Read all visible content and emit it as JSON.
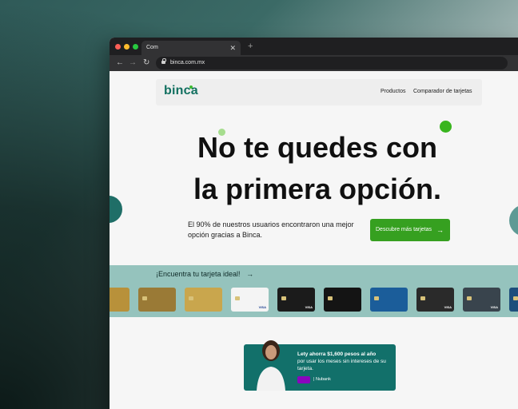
{
  "browser": {
    "tab_title": "Com",
    "tab_close": "✕",
    "new_tab": "+",
    "url": "binca.com.mx",
    "nav_back": "←",
    "nav_forward": "→",
    "reload": "↻"
  },
  "site": {
    "logo": "binca",
    "nav": {
      "products": "Productos",
      "comparator": "Comparador de tarjetas"
    }
  },
  "hero": {
    "line1": "No te quedes con",
    "line2": "la primera opción.",
    "subtitle": "El 90% de nuestros usuarios encontraron una mejor opción gracias a Binca.",
    "cta": "Descubre más tarjetas",
    "cta_arrow": "→"
  },
  "cards_band": {
    "label": "¡Encuentra tu tarjeta ideal!",
    "arrow": "→",
    "cards": [
      {
        "name": "gold-card",
        "color": "#b8913a",
        "brand": ""
      },
      {
        "name": "aeromexico-card",
        "color": "#9a7a36",
        "brand": ""
      },
      {
        "name": "amex-gold-card",
        "color": "#c9a64d",
        "brand": ""
      },
      {
        "name": "white-card",
        "color": "#f4f4f4",
        "brand": "VISA"
      },
      {
        "name": "black-card",
        "color": "#1b1b1b",
        "brand": "VISA"
      },
      {
        "name": "santander-black-card",
        "color": "#141414",
        "brand": ""
      },
      {
        "name": "citibanamex-card",
        "color": "#1b5d9a",
        "brand": ""
      },
      {
        "name": "dark-card",
        "color": "#2a2a2a",
        "brand": "VISA"
      },
      {
        "name": "banregio-card",
        "color": "#39444d",
        "brand": "VISA"
      },
      {
        "name": "blue-card",
        "color": "#1d4e7c",
        "brand": "VISA"
      }
    ]
  },
  "promo": {
    "line1": "Lety ahorra $1,600 pesos al año",
    "line2": "por usar los meses sin intereses de su tarjeta.",
    "brand": "| Nubank"
  },
  "colors": {
    "accent_green": "#36a020",
    "brand_teal": "#127060",
    "band": "#95c3bd"
  }
}
